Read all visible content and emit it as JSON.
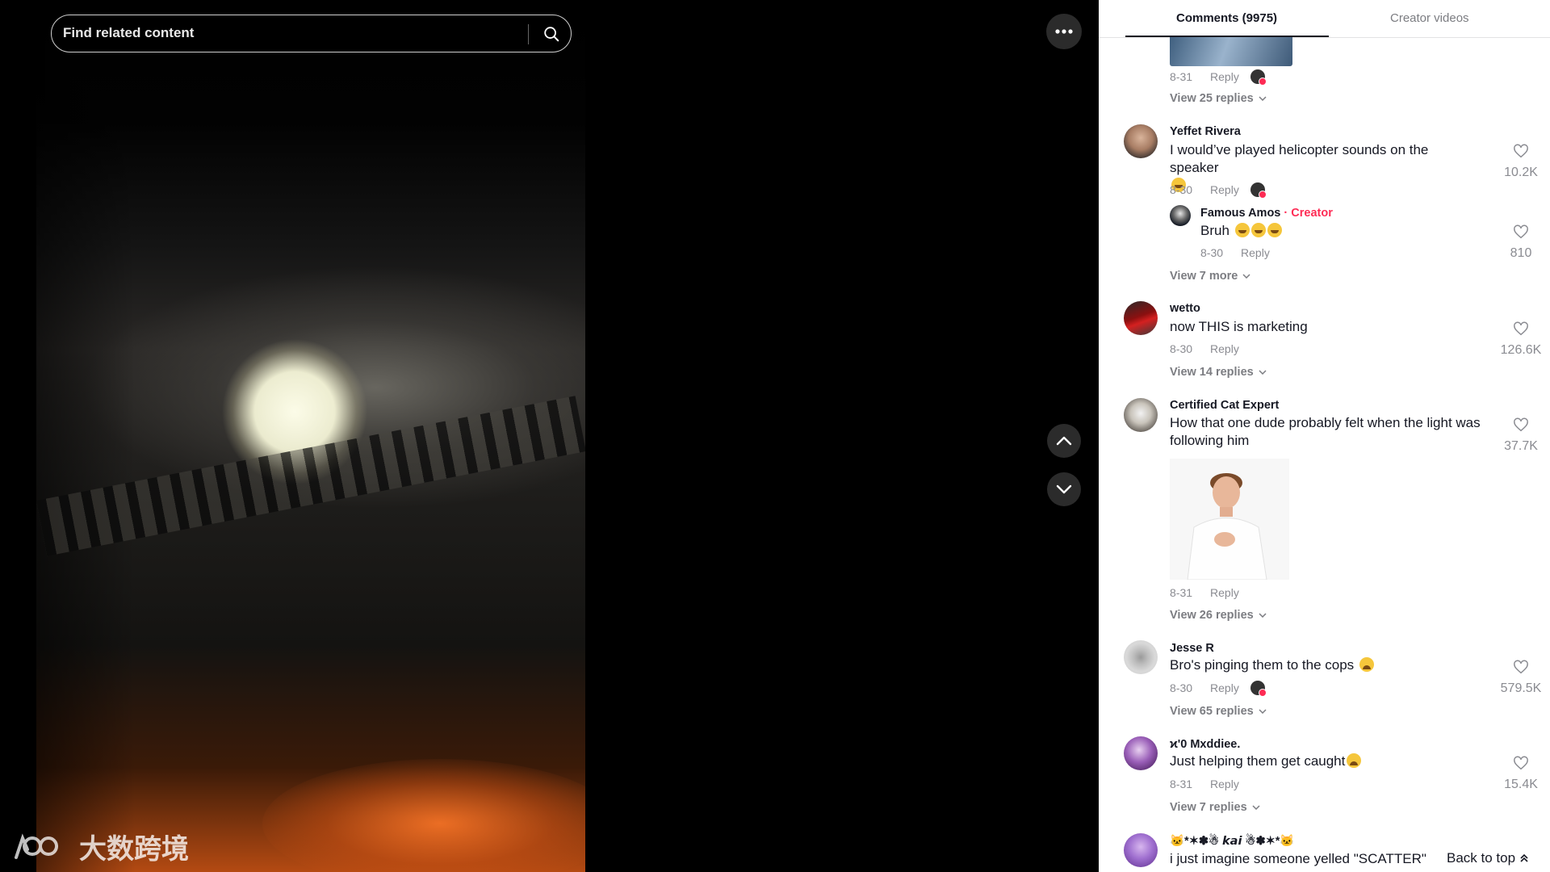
{
  "search": {
    "placeholder": "Find related content"
  },
  "icons": {
    "search": "search-icon",
    "more": "more-horizontal-icon",
    "up": "chevron-up-icon",
    "down": "chevron-down-icon",
    "like": "heart-icon"
  },
  "watermark": {
    "text": "大数跨境"
  },
  "tabs": {
    "comments": "Comments (9975)",
    "creator": "Creator videos"
  },
  "top_comment": {
    "date": "8-31",
    "reply": "Reply",
    "view_replies": "View 25 replies"
  },
  "comments": [
    {
      "user": "Yeffet Rivera",
      "text": "I would’ve played helicopter sounds on the speaker",
      "date": "8-30",
      "reply": "Reply",
      "likes": "10.2K",
      "view_more": "View 7 more",
      "sub": {
        "user": "Famous Amos",
        "tag": " · Creator",
        "text": "Bruh",
        "date": "8-30",
        "reply": "Reply",
        "likes": "810"
      }
    },
    {
      "user": "wetto",
      "text": "now THIS is marketing",
      "date": "8-30",
      "reply": "Reply",
      "likes": "126.6K",
      "view_replies": "View 14 replies"
    },
    {
      "user": "Certified Cat Expert",
      "text_line1": "How that one dude probably felt when the light was",
      "text_line2": "following him",
      "date": "8-31",
      "reply": "Reply",
      "likes": "37.7K",
      "view_replies": "View 26 replies"
    },
    {
      "user": "Jesse R",
      "text": "Bro's pinging them to the cops",
      "date": "8-30",
      "reply": "Reply",
      "likes": "579.5K",
      "view_replies": "View 65 replies"
    },
    {
      "user": "ϰ'0 Mxddiee.",
      "text": "Just helping them get caught",
      "date": "8-31",
      "reply": "Reply",
      "likes": "15.4K",
      "view_replies": "View 7 replies"
    },
    {
      "user": "🐱*✶✽☃ 𝙠𝙖𝙞 ☃✽✶*🐱",
      "text": "i just imagine someone yelled \"SCATTER\""
    }
  ],
  "back_to_top": "Back to top"
}
